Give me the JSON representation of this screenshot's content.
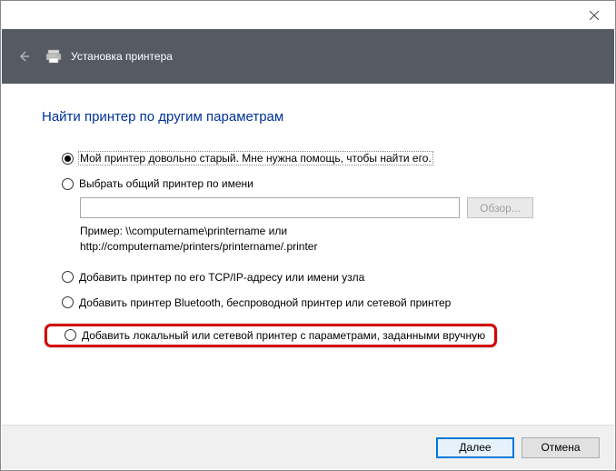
{
  "header": {
    "title": "Установка принтера"
  },
  "page": {
    "title": "Найти принтер по другим параметрам"
  },
  "options": {
    "old_printer": "Мой принтер довольно старый. Мне нужна помощь, чтобы найти его.",
    "shared_by_name": "Выбрать общий принтер по имени",
    "shared_input_value": "",
    "browse_label": "Обзор...",
    "example_line1": "Пример: \\\\computername\\printername или",
    "example_line2": "http://computername/printers/printername/.printer",
    "tcp_ip": "Добавить принтер по его TCP/IP-адресу или имени узла",
    "bluetooth": "Добавить принтер Bluetooth, беспроводной принтер или сетевой принтер",
    "manual": "Добавить локальный или сетевой принтер с параметрами, заданными вручную"
  },
  "footer": {
    "next": "Далее",
    "cancel": "Отмена"
  }
}
